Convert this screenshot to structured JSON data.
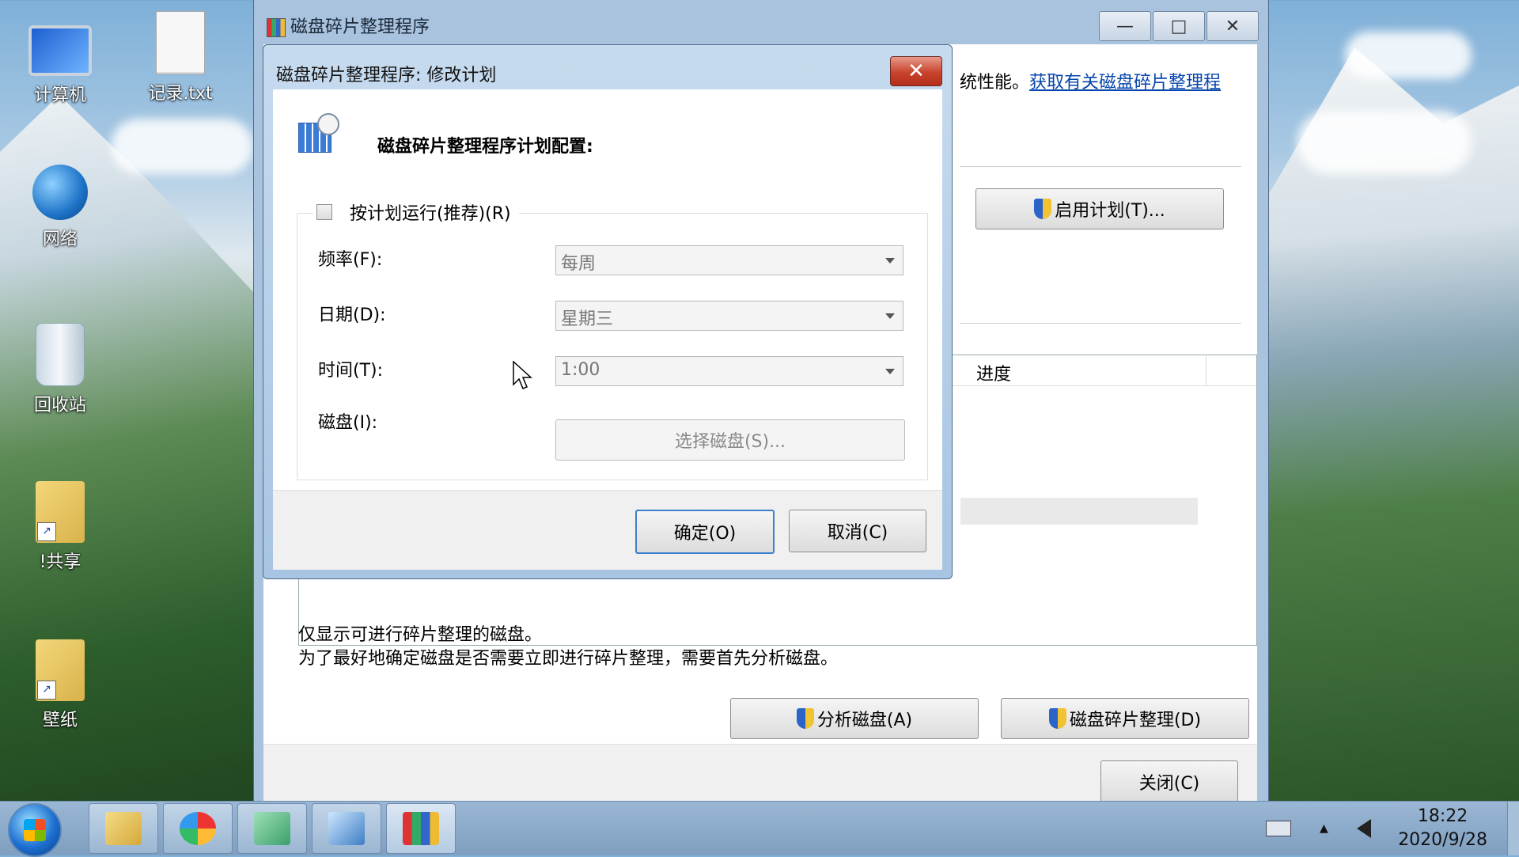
{
  "desktop": {
    "icons": [
      {
        "label": "计算机"
      },
      {
        "label": "记录.txt"
      },
      {
        "label": "网络"
      },
      {
        "label": "回收站"
      },
      {
        "label": "!共享"
      },
      {
        "label": "壁纸"
      }
    ]
  },
  "main_window": {
    "title": "磁盘碎片整理程序",
    "caption": {
      "minimize": "—",
      "maximize": "□",
      "close": "✕"
    },
    "top_text": "统性能。",
    "top_link": "获取有关磁盘碎片整理程",
    "enable_schedule_btn": "启用计划(T)...",
    "progress_header": "进度",
    "note_line1": "仅显示可进行碎片整理的磁盘。",
    "note_line2": "为了最好地确定磁盘是否需要立即进行碎片整理，需要首先分析磁盘。",
    "analyze_btn": "分析磁盘(A)",
    "defrag_btn": "磁盘碎片整理(D)",
    "close_btn": "关闭(C)"
  },
  "dialog": {
    "title": "磁盘碎片整理程序: 修改计划",
    "close_glyph": "✕",
    "heading": "磁盘碎片整理程序计划配置:",
    "run_on_schedule": {
      "label": "按计划运行(推荐)(R)",
      "checked": false
    },
    "frequency": {
      "label": "频率(F):",
      "value": "每周"
    },
    "day": {
      "label": "日期(D):",
      "value": "星期三"
    },
    "time": {
      "label": "时间(T):",
      "value": "1:00"
    },
    "disks": {
      "label": "磁盘(I):",
      "button": "选择磁盘(S)..."
    },
    "ok_btn": "确定(O)",
    "cancel_btn": "取消(C)"
  },
  "taskbar": {
    "tray_arrow": "▲",
    "time": "18:22",
    "date": "2020/9/28"
  }
}
